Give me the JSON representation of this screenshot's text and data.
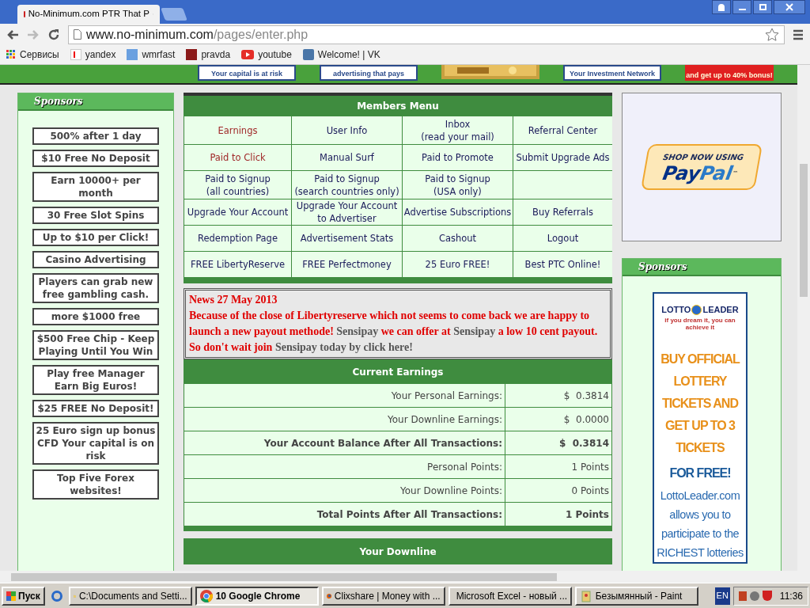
{
  "browser": {
    "tab_title": "No-Minimum.com PTR That P",
    "url_host": "www.no-minimum.com",
    "url_path": "/pages/enter.php",
    "bookmarks": [
      {
        "label": "Сервисы"
      },
      {
        "label": "yandex"
      },
      {
        "label": "wmrfast"
      },
      {
        "label": "pravda"
      },
      {
        "label": "youtube"
      },
      {
        "label": "Welcome! | VK"
      }
    ]
  },
  "top_banners": [
    {
      "text": "Your capital is at risk"
    },
    {
      "text": "advertising that pays"
    },
    {
      "kind": "picture"
    },
    {
      "text": "Your Investment Network"
    },
    {
      "text": "and get up to 40% bonus!"
    }
  ],
  "left_sponsors": {
    "title": "Sponsors",
    "items": [
      "500% after 1 day",
      "$10 Free No Deposit",
      "Earn 10000+ per month",
      "30 Free Slot Spins",
      "Up to $10 per Click!",
      "Casino Advertising",
      "Players can grab new free gambling cash.",
      "more $1000 free",
      "$500 Free Chip - Keep Playing Until You Win",
      "Play free Manager Earn Big Euros!",
      "$25 FREE No Deposit!",
      "25 Euro sign up bonus CFD Your capital is on risk",
      "Top Five Forex websites!"
    ]
  },
  "members_menu": {
    "title": "Members Menu",
    "rows": [
      [
        {
          "lines": [
            "Earnings"
          ],
          "visited": true
        },
        {
          "lines": [
            "User Info"
          ],
          "visited": false
        },
        {
          "lines": [
            "Inbox",
            "(read your mail)"
          ],
          "visited": false
        },
        {
          "lines": [
            "Referral Center"
          ],
          "visited": false
        }
      ],
      [
        {
          "lines": [
            "Paid to Click"
          ],
          "visited": true
        },
        {
          "lines": [
            "Manual Surf"
          ],
          "visited": false
        },
        {
          "lines": [
            "Paid to Promote"
          ],
          "visited": false
        },
        {
          "lines": [
            "Submit Upgrade Ads"
          ],
          "visited": false
        }
      ],
      [
        {
          "lines": [
            "Paid to Signup",
            "(all countries)"
          ],
          "visited": false
        },
        {
          "lines": [
            "Paid to Signup",
            "(search countries only)"
          ],
          "visited": false
        },
        {
          "lines": [
            "Paid to Signup",
            "(USA only)"
          ],
          "visited": false
        },
        null
      ],
      [
        {
          "lines": [
            "Upgrade Your Account"
          ],
          "visited": false
        },
        {
          "lines": [
            "Upgrade Your Account",
            "to Advertiser"
          ],
          "visited": false
        },
        {
          "lines": [
            "Advertise Subscriptions"
          ],
          "visited": false
        },
        {
          "lines": [
            "Buy Referrals"
          ],
          "visited": false
        }
      ],
      [
        {
          "lines": [
            "Redemption Page"
          ],
          "visited": false
        },
        {
          "lines": [
            "Advertisement Stats"
          ],
          "visited": false
        },
        {
          "lines": [
            "Cashout"
          ],
          "visited": false
        },
        {
          "lines": [
            "Logout"
          ],
          "visited": false
        }
      ],
      [
        {
          "lines": [
            "FREE LibertyReserve"
          ],
          "visited": false
        },
        {
          "lines": [
            "FREE Perfectmoney"
          ],
          "visited": false
        },
        {
          "lines": [
            "25 Euro FREE!"
          ],
          "visited": false
        },
        {
          "lines": [
            "Best PTC Online!"
          ],
          "visited": false
        }
      ]
    ]
  },
  "news": {
    "heading": "News 27 May 2013",
    "segments": [
      {
        "kind": "text",
        "text": "Because of the close of Libertyreserve which not seems to come back we are happy to launch a new payout methode!"
      },
      {
        "kind": "link",
        "text": "Sensipay"
      },
      {
        "kind": "text",
        "text": "we can offer at"
      },
      {
        "kind": "link",
        "text": "Sensipay"
      },
      {
        "kind": "text",
        "text": "a low 10 cent payout. So don't wait join"
      },
      {
        "kind": "link",
        "text": "Sensipay today by click here!"
      }
    ]
  },
  "current_earnings": {
    "title": "Current Earnings",
    "rows": [
      {
        "label": "Your Personal Earnings:",
        "value": "$  0.3814",
        "bold": false
      },
      {
        "label": "Your Downline Earnings:",
        "value": "$  0.0000",
        "bold": false
      },
      {
        "label": "Your Account Balance After All Transactions:",
        "value": "$  0.3814",
        "bold": true
      },
      {
        "label": "Personal Points:",
        "value": "1 Points",
        "bold": false
      },
      {
        "label": "Your Downline Points:",
        "value": "0 Points",
        "bold": false
      },
      {
        "label": "Total Points After All Transactions:",
        "value": "1 Points",
        "bold": true
      }
    ]
  },
  "downline": {
    "title": "Your Downline"
  },
  "paypal_ad": {
    "line1": "SHOP NOW USING",
    "brand_a": "Pay",
    "brand_b": "Pal",
    "tm": "™"
  },
  "right_sponsors": {
    "title": "Sponsors",
    "ad": {
      "logo_a": "LOTTO",
      "logo_b": "LEADER",
      "tagline": "if you dream it, you can achieve it",
      "headline": "BUY OFFICIAL LOTTERY TICKETS AND GET UP TO 3 TICKETS",
      "offer": "FOR FREE!",
      "body": "LottoLeader.com allows you to participate to the RICHEST lotteries"
    }
  },
  "taskbar": {
    "start": "Пуск",
    "tasks": [
      {
        "label": "C:\\Documents and Setti...",
        "selected": false
      },
      {
        "label": "10 Google Chrome",
        "selected": true
      },
      {
        "label": "Clixshare | Money with ...",
        "selected": false
      },
      {
        "label": "Microsoft Excel - новый ...",
        "selected": false
      },
      {
        "label": "Безымянный - Paint",
        "selected": false
      }
    ],
    "lang": "EN",
    "clock": "11:36"
  }
}
